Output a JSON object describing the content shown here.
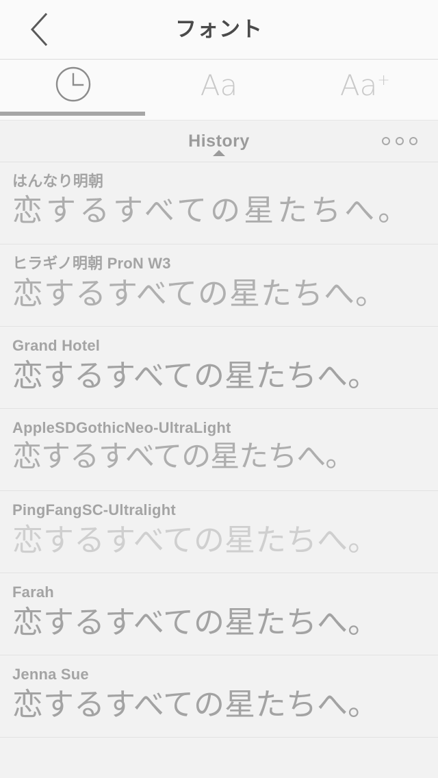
{
  "navbar": {
    "back_icon": "chevron-left-icon",
    "title": "フォント"
  },
  "tabs": [
    {
      "id": "history",
      "icon": "clock-icon",
      "label": "",
      "active": true
    },
    {
      "id": "fonts",
      "icon": "",
      "label": "Aa",
      "active": false
    },
    {
      "id": "add-font",
      "icon": "",
      "label": "Aa",
      "label_sup": "+",
      "active": false
    }
  ],
  "section": {
    "title": "History",
    "caret_icon": "triangle-up-icon",
    "overflow_icon": "more-options-icon"
  },
  "font_list": [
    {
      "name": "はんなり明朝",
      "sample": "恋するすべての星たちへ。",
      "style": "sample-mincho"
    },
    {
      "name": "ヒラギノ明朝 ProN W3",
      "sample": "恋するすべての星たちへ。",
      "style": "sample-mincho2"
    },
    {
      "name": "Grand Hotel",
      "sample": "恋するすべての星たちへ。",
      "style": "sample-gothic"
    },
    {
      "name": "AppleSDGothicNeo-UltraLight",
      "sample": "恋するすべての星たちへ。",
      "style": "sample-gothic-light"
    },
    {
      "name": "PingFangSC-Ultralight",
      "sample": "恋するすべての星たちへ。",
      "style": "sample-ultralight"
    },
    {
      "name": "Farah",
      "sample": "恋するすべての星たちへ。",
      "style": "sample-gothic"
    },
    {
      "name": "Jenna Sue",
      "sample": "恋するすべての星たちへ。",
      "style": "sample-gothic"
    }
  ],
  "colors": {
    "background": "#f2f2f2",
    "bar_background": "#fafafa",
    "title_text": "#4a4a4a",
    "muted_text": "#a4a4a4",
    "inactive_tab": "#c9c9c9",
    "indicator": "#a6a6a6",
    "divider": "#e2e2e2"
  }
}
